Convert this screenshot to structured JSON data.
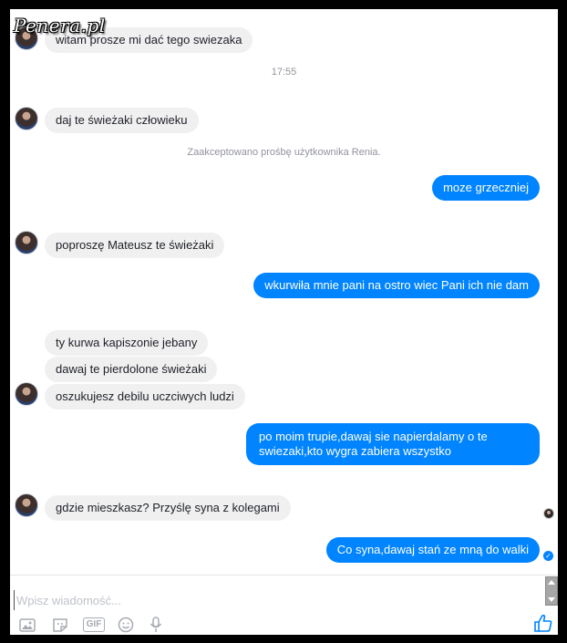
{
  "watermark": "Penera.pl",
  "messages": [
    {
      "text": "witam prosze mi dać tego swiezaka"
    },
    {
      "text": "daj te świeżaki człowieku"
    },
    {
      "text": "moze grzeczniej"
    },
    {
      "text": "poproszę Mateusz te świeżaki"
    },
    {
      "text": "wkurwiła mnie pani na ostro wiec Pani ich nie dam"
    },
    {
      "text": "ty kurwa kapiszonie jebany"
    },
    {
      "text": "dawaj te pierdolone świeżaki"
    },
    {
      "text": "oszukujesz debilu uczciwych ludzi"
    },
    {
      "text": "po moim trupie,dawaj sie napierdalamy o te swiezaki,kto wygra zabiera wszystko"
    },
    {
      "text": "gdzie mieszkasz? Przyślę syna z kolegami"
    },
    {
      "text": "Co syna,dawaj stań ze mną do walki"
    }
  ],
  "timestamp": "17:55",
  "system_message": "Zaakceptowano prośbę użytkownika Renia.",
  "composer": {
    "placeholder": "Wpisz wiadomość..."
  },
  "toolbar": {
    "gif_label": "GIF"
  },
  "colors": {
    "outgoing": "#0084ff",
    "incoming": "#f1f0f0"
  }
}
